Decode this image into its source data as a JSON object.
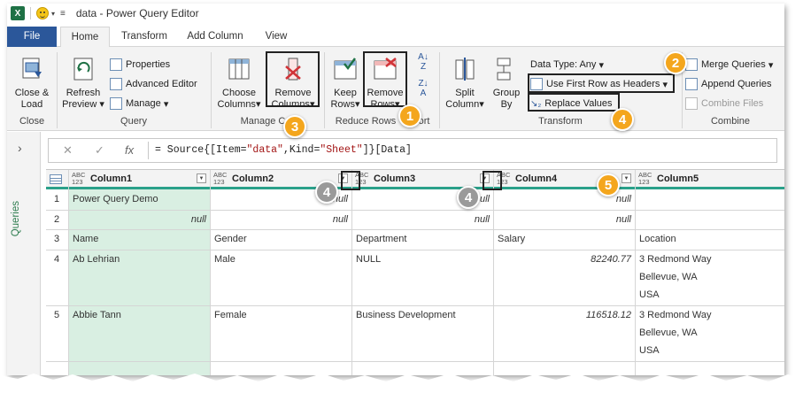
{
  "app": {
    "title": "data - Power Query Editor"
  },
  "tabs": [
    "File",
    "Home",
    "Transform",
    "Add Column",
    "View"
  ],
  "ribbon": {
    "close": {
      "btn1": "Close &",
      "btn2": "Load",
      "group": "Close"
    },
    "query": {
      "refresh1": "Refresh",
      "refresh2": "Preview",
      "properties": "Properties",
      "advanced": "Advanced Editor",
      "manage": "Manage",
      "group": "Query"
    },
    "manage_columns": {
      "choose1": "Choose",
      "choose2": "Columns",
      "remove1": "Remove",
      "remove2": "Columns",
      "group": "Manage Co"
    },
    "reduce_rows": {
      "keep1": "Keep",
      "keep2": "Rows",
      "remove1": "Remove",
      "remove2": "Rows",
      "group": "Reduce Rows",
      "sort": "ort"
    },
    "transform": {
      "split1": "Split",
      "split2": "Column",
      "group1": "Group",
      "group2": "By",
      "datatype": "Data Type: Any",
      "first_row": "Use First Row as Headers",
      "replace": "Replace Values",
      "group": "Transform"
    },
    "combine": {
      "merge": "Merge Queries",
      "append": "Append Queries",
      "combine_files": "Combine Files",
      "group": "Combine"
    }
  },
  "callouts": [
    "1",
    "2",
    "3",
    "4",
    "4",
    "4",
    "5"
  ],
  "queries_label": "Queries",
  "formula": {
    "prefix": "= Source{[Item=",
    "s1": "\"data\"",
    "mid": ",Kind=",
    "s2": "\"Sheet\"",
    "suffix": "]}[Data]"
  },
  "grid": {
    "type_label": "ABC\n123",
    "columns": [
      "Column1",
      "Column2",
      "Column3",
      "Column4",
      "Column5"
    ],
    "rownums": [
      "1",
      "2",
      "3",
      "4",
      "5"
    ],
    "rows": [
      [
        "Power Query Demo",
        "null",
        "null",
        "null",
        ""
      ],
      [
        "null",
        "null",
        "null",
        "null",
        ""
      ],
      [
        "Name",
        "Gender",
        "Department",
        "Salary",
        "Location"
      ],
      [
        "Ab Lehrian",
        "Male",
        "NULL",
        "82240.77",
        "3 Redmond Way"
      ],
      [
        "Abbie Tann",
        "Female",
        "Business Development",
        "116518.12",
        "3 Redmond Way"
      ]
    ],
    "row4_extra": [
      "Bellevue, WA",
      "USA"
    ],
    "row5_extra": [
      "Bellevue, WA",
      "USA"
    ]
  },
  "colors": {
    "accent": "#2b579a",
    "excel_green": "#1e7145",
    "callout": "#f4a61d",
    "header_bar": "#2aa08a",
    "selected_column": "#d9efe2"
  }
}
